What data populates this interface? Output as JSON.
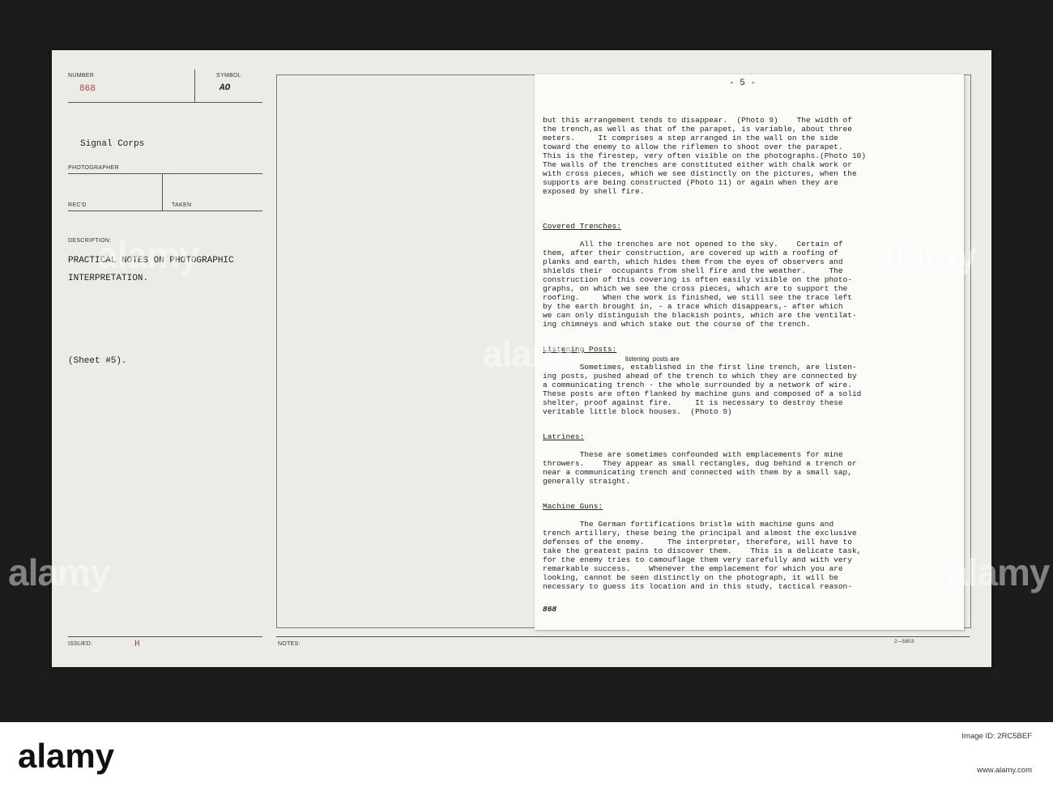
{
  "card": {
    "number_label": "NUMBER",
    "number_value": "868",
    "symbol_label": "SYMBOL",
    "symbol_value": "AO",
    "photographer_value": "Signal Corps",
    "photographer_label": "PHOTOGRAPHER",
    "recd_label": "REC'D",
    "taken_label": "TAKEN",
    "description_label": "DESCRIPTION:",
    "description_line1": "PRACTICAL NOTES ON PHOTOGRAPHIC",
    "description_line2": "INTERPRETATION.",
    "sheet_note": "(Sheet #5).",
    "issued_label": "ISSUED:",
    "issued_value": "H",
    "notes_label": "NOTES:",
    "form_code": "2—5803"
  },
  "sheet": {
    "page_number": "- 5 -",
    "lines_intro": [
      "but this arrangement tends to disappear.  (Photo 9)    The width of",
      "the trench,as well as that of the parapet, is variable, about three",
      "meters.     It comprises a step arranged in the wall on the side",
      "toward the enemy to allow the riflemen to shoot over the parapet.",
      "This is the firestep, very often visible on the photographs.(Photo 10)",
      "The walls of the trenches are constituted either with chalk work or",
      "with cross pieces, which we see distinctly on the pictures, when the",
      "supports are being constructed (Photo 11) or again when they are",
      "exposed by shell fire."
    ],
    "heading_covered": "Covered Trenches:",
    "lines_covered": [
      "        All the trenches are not opened to the sky.    Certain of",
      "them, after their construction, are covered up with a roofing of",
      "planks and earth, which hides them from the eyes of observers and",
      "shields their  occupants from shell fire and the weather.     The",
      "construction of this covering is often easily visible on the photo-",
      "graphs, on which we see the cross pieces, which are to support the",
      "roofing.     When the work is finished, we still see the trace left",
      "by the earth brought in, - a trace which disappears,- after which",
      "we can only distinguish the blackish points, which are the ventilat-",
      "ing chimneys and which stake out the course of the trench."
    ],
    "heading_listening": "Listening Posts:",
    "listening_insertion": "listening  posts are",
    "lines_listening": [
      "        Sometimes, established in the first line trench, are listen-",
      "ing posts, pushed ahead of the trench to which they are connected by",
      "a communicating trench - the whole surrounded by a network of wire.",
      "These posts are often flanked by machine guns and composed of a solid",
      "shelter, proof against fire.     It is necessary to destroy these",
      "veritable little block houses.  (Photo 9)"
    ],
    "heading_latrines": "Latrines:",
    "lines_latrines": [
      "        These are sometimes confounded with emplacements for mine",
      "throwers.    They appear as small rectangles, dug behind a trench or",
      "near a communicating trench and connected with them by a small sap,",
      "generally straight."
    ],
    "heading_machine": "Machine Guns:",
    "lines_machine": [
      "        The German fortifications bristle with machine guns and",
      "trench artillery, these being the principal and almost the exclusive",
      "defenses of the enemy.     The interpreter, therefore, will have to",
      "take the greatest pains to discover them.    This is a delicate task,",
      "for the enemy tries to camouflage them very carefully and with very",
      "remarkable success.    Whenever the emplacement for which you are",
      "looking, cannot be seen distinctly on the photograph, it will be",
      "necessary to guess its location and in this study, tactical reason-"
    ],
    "handwritten_mark": "868"
  },
  "watermark": {
    "text": "alamy"
  },
  "footer": {
    "logo": "alamy",
    "image_id_line": "Image ID: 2RC5BEF",
    "url": "www.alamy.com"
  }
}
